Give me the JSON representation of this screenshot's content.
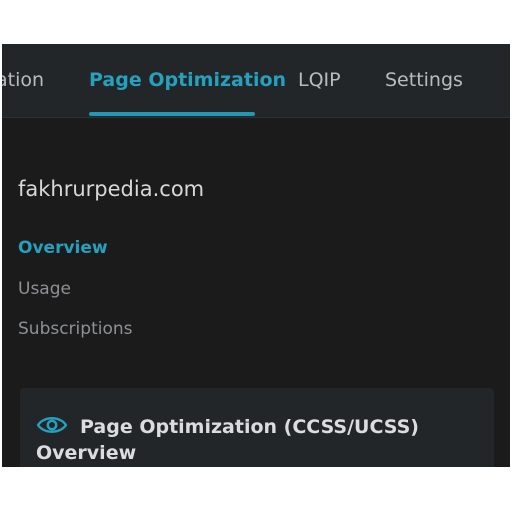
{
  "tabs": [
    {
      "label": "ation",
      "active": false
    },
    {
      "label": "Page Optimization",
      "active": true
    },
    {
      "label": "LQIP",
      "active": false
    },
    {
      "label": "Settings",
      "active": false
    }
  ],
  "site": {
    "title": "fakhrurpedia.com"
  },
  "subnav": [
    {
      "label": "Overview",
      "active": true
    },
    {
      "label": "Usage",
      "active": false
    },
    {
      "label": "Subscriptions",
      "active": false
    }
  ],
  "card": {
    "icon": "eye-icon",
    "title": "Page Optimization (CCSS/UCSS) Overview"
  },
  "colors": {
    "accent": "#25a0bd",
    "background": "#1b1b1c",
    "panel": "#232629",
    "text_muted": "#8e9194"
  }
}
